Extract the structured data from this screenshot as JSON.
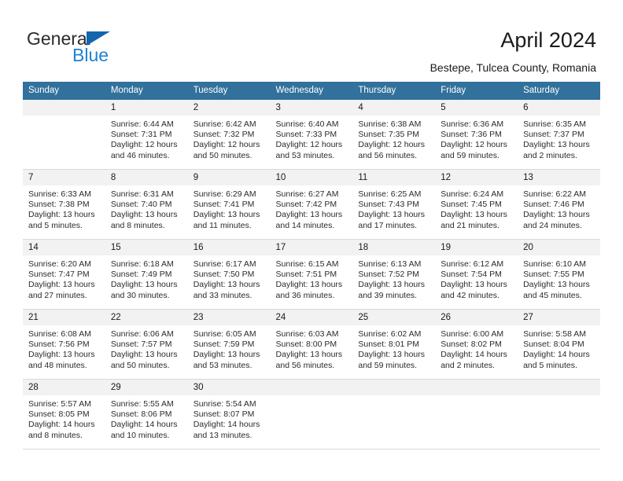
{
  "brand": {
    "name_part1": "General",
    "name_part2": "Blue",
    "accent_color": "#1166ad",
    "accent_color_light": "#1f82d4"
  },
  "header": {
    "title": "April 2024",
    "subtitle": "Bestepe, Tulcea County, Romania"
  },
  "calendar": {
    "header_bg": "#31719b",
    "day_band_bg": "#f2f2f2",
    "weekday_headers": [
      "Sunday",
      "Monday",
      "Tuesday",
      "Wednesday",
      "Thursday",
      "Friday",
      "Saturday"
    ],
    "weeks": [
      [
        {
          "day": "",
          "sunrise": "",
          "sunset": "",
          "daylight1": "",
          "daylight2": ""
        },
        {
          "day": "1",
          "sunrise": "Sunrise: 6:44 AM",
          "sunset": "Sunset: 7:31 PM",
          "daylight1": "Daylight: 12 hours",
          "daylight2": "and 46 minutes."
        },
        {
          "day": "2",
          "sunrise": "Sunrise: 6:42 AM",
          "sunset": "Sunset: 7:32 PM",
          "daylight1": "Daylight: 12 hours",
          "daylight2": "and 50 minutes."
        },
        {
          "day": "3",
          "sunrise": "Sunrise: 6:40 AM",
          "sunset": "Sunset: 7:33 PM",
          "daylight1": "Daylight: 12 hours",
          "daylight2": "and 53 minutes."
        },
        {
          "day": "4",
          "sunrise": "Sunrise: 6:38 AM",
          "sunset": "Sunset: 7:35 PM",
          "daylight1": "Daylight: 12 hours",
          "daylight2": "and 56 minutes."
        },
        {
          "day": "5",
          "sunrise": "Sunrise: 6:36 AM",
          "sunset": "Sunset: 7:36 PM",
          "daylight1": "Daylight: 12 hours",
          "daylight2": "and 59 minutes."
        },
        {
          "day": "6",
          "sunrise": "Sunrise: 6:35 AM",
          "sunset": "Sunset: 7:37 PM",
          "daylight1": "Daylight: 13 hours",
          "daylight2": "and 2 minutes."
        }
      ],
      [
        {
          "day": "7",
          "sunrise": "Sunrise: 6:33 AM",
          "sunset": "Sunset: 7:38 PM",
          "daylight1": "Daylight: 13 hours",
          "daylight2": "and 5 minutes."
        },
        {
          "day": "8",
          "sunrise": "Sunrise: 6:31 AM",
          "sunset": "Sunset: 7:40 PM",
          "daylight1": "Daylight: 13 hours",
          "daylight2": "and 8 minutes."
        },
        {
          "day": "9",
          "sunrise": "Sunrise: 6:29 AM",
          "sunset": "Sunset: 7:41 PM",
          "daylight1": "Daylight: 13 hours",
          "daylight2": "and 11 minutes."
        },
        {
          "day": "10",
          "sunrise": "Sunrise: 6:27 AM",
          "sunset": "Sunset: 7:42 PM",
          "daylight1": "Daylight: 13 hours",
          "daylight2": "and 14 minutes."
        },
        {
          "day": "11",
          "sunrise": "Sunrise: 6:25 AM",
          "sunset": "Sunset: 7:43 PM",
          "daylight1": "Daylight: 13 hours",
          "daylight2": "and 17 minutes."
        },
        {
          "day": "12",
          "sunrise": "Sunrise: 6:24 AM",
          "sunset": "Sunset: 7:45 PM",
          "daylight1": "Daylight: 13 hours",
          "daylight2": "and 21 minutes."
        },
        {
          "day": "13",
          "sunrise": "Sunrise: 6:22 AM",
          "sunset": "Sunset: 7:46 PM",
          "daylight1": "Daylight: 13 hours",
          "daylight2": "and 24 minutes."
        }
      ],
      [
        {
          "day": "14",
          "sunrise": "Sunrise: 6:20 AM",
          "sunset": "Sunset: 7:47 PM",
          "daylight1": "Daylight: 13 hours",
          "daylight2": "and 27 minutes."
        },
        {
          "day": "15",
          "sunrise": "Sunrise: 6:18 AM",
          "sunset": "Sunset: 7:49 PM",
          "daylight1": "Daylight: 13 hours",
          "daylight2": "and 30 minutes."
        },
        {
          "day": "16",
          "sunrise": "Sunrise: 6:17 AM",
          "sunset": "Sunset: 7:50 PM",
          "daylight1": "Daylight: 13 hours",
          "daylight2": "and 33 minutes."
        },
        {
          "day": "17",
          "sunrise": "Sunrise: 6:15 AM",
          "sunset": "Sunset: 7:51 PM",
          "daylight1": "Daylight: 13 hours",
          "daylight2": "and 36 minutes."
        },
        {
          "day": "18",
          "sunrise": "Sunrise: 6:13 AM",
          "sunset": "Sunset: 7:52 PM",
          "daylight1": "Daylight: 13 hours",
          "daylight2": "and 39 minutes."
        },
        {
          "day": "19",
          "sunrise": "Sunrise: 6:12 AM",
          "sunset": "Sunset: 7:54 PM",
          "daylight1": "Daylight: 13 hours",
          "daylight2": "and 42 minutes."
        },
        {
          "day": "20",
          "sunrise": "Sunrise: 6:10 AM",
          "sunset": "Sunset: 7:55 PM",
          "daylight1": "Daylight: 13 hours",
          "daylight2": "and 45 minutes."
        }
      ],
      [
        {
          "day": "21",
          "sunrise": "Sunrise: 6:08 AM",
          "sunset": "Sunset: 7:56 PM",
          "daylight1": "Daylight: 13 hours",
          "daylight2": "and 48 minutes."
        },
        {
          "day": "22",
          "sunrise": "Sunrise: 6:06 AM",
          "sunset": "Sunset: 7:57 PM",
          "daylight1": "Daylight: 13 hours",
          "daylight2": "and 50 minutes."
        },
        {
          "day": "23",
          "sunrise": "Sunrise: 6:05 AM",
          "sunset": "Sunset: 7:59 PM",
          "daylight1": "Daylight: 13 hours",
          "daylight2": "and 53 minutes."
        },
        {
          "day": "24",
          "sunrise": "Sunrise: 6:03 AM",
          "sunset": "Sunset: 8:00 PM",
          "daylight1": "Daylight: 13 hours",
          "daylight2": "and 56 minutes."
        },
        {
          "day": "25",
          "sunrise": "Sunrise: 6:02 AM",
          "sunset": "Sunset: 8:01 PM",
          "daylight1": "Daylight: 13 hours",
          "daylight2": "and 59 minutes."
        },
        {
          "day": "26",
          "sunrise": "Sunrise: 6:00 AM",
          "sunset": "Sunset: 8:02 PM",
          "daylight1": "Daylight: 14 hours",
          "daylight2": "and 2 minutes."
        },
        {
          "day": "27",
          "sunrise": "Sunrise: 5:58 AM",
          "sunset": "Sunset: 8:04 PM",
          "daylight1": "Daylight: 14 hours",
          "daylight2": "and 5 minutes."
        }
      ],
      [
        {
          "day": "28",
          "sunrise": "Sunrise: 5:57 AM",
          "sunset": "Sunset: 8:05 PM",
          "daylight1": "Daylight: 14 hours",
          "daylight2": "and 8 minutes."
        },
        {
          "day": "29",
          "sunrise": "Sunrise: 5:55 AM",
          "sunset": "Sunset: 8:06 PM",
          "daylight1": "Daylight: 14 hours",
          "daylight2": "and 10 minutes."
        },
        {
          "day": "30",
          "sunrise": "Sunrise: 5:54 AM",
          "sunset": "Sunset: 8:07 PM",
          "daylight1": "Daylight: 14 hours",
          "daylight2": "and 13 minutes."
        },
        {
          "day": "",
          "sunrise": "",
          "sunset": "",
          "daylight1": "",
          "daylight2": ""
        },
        {
          "day": "",
          "sunrise": "",
          "sunset": "",
          "daylight1": "",
          "daylight2": ""
        },
        {
          "day": "",
          "sunrise": "",
          "sunset": "",
          "daylight1": "",
          "daylight2": ""
        },
        {
          "day": "",
          "sunrise": "",
          "sunset": "",
          "daylight1": "",
          "daylight2": ""
        }
      ]
    ]
  }
}
